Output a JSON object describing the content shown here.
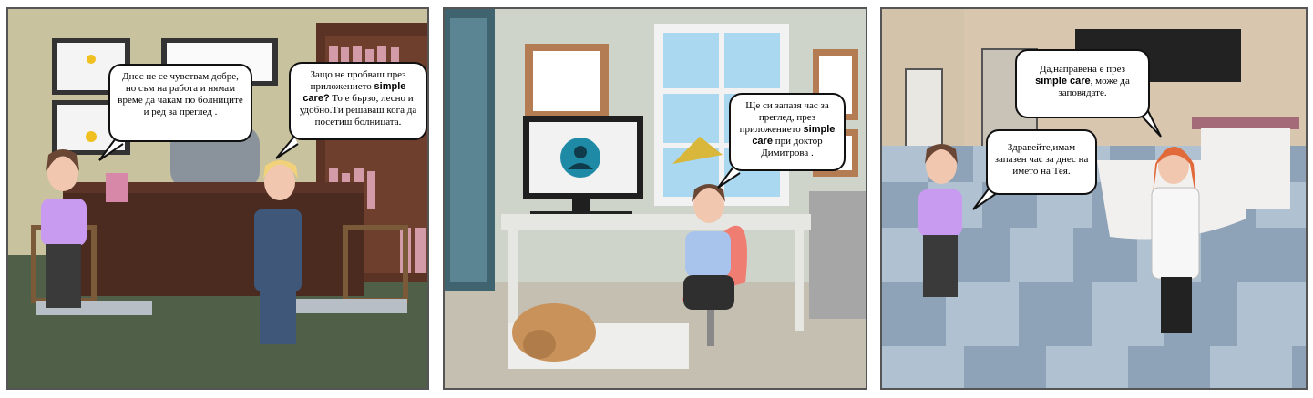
{
  "panels": [
    {
      "bubbles": [
        {
          "text_before": "Днес не се чувствам добре, но съм на работа и нямам време да чакам по болниците и ред за преглед .",
          "bold": "",
          "text_after": ""
        },
        {
          "text_before": "Защо не пробваш през приложението ",
          "bold": "simple care?",
          "text_after": " То е бързо, лесно и удобно.Ти решаваш кога да  посетиш болницата."
        }
      ]
    },
    {
      "bubbles": [
        {
          "text_before": "Ще си запазя час за преглед, през приложението ",
          "bold": "simple care",
          "text_after": " при доктор Димитрова ."
        }
      ]
    },
    {
      "bubbles": [
        {
          "text_before": "Да,направена е през ",
          "bold": "simple care",
          "text_after": ", може да заповядате."
        },
        {
          "text_before": "Здравейте,имам запазен час за днес на името на Тея.",
          "bold": "",
          "text_after": ""
        }
      ]
    }
  ]
}
